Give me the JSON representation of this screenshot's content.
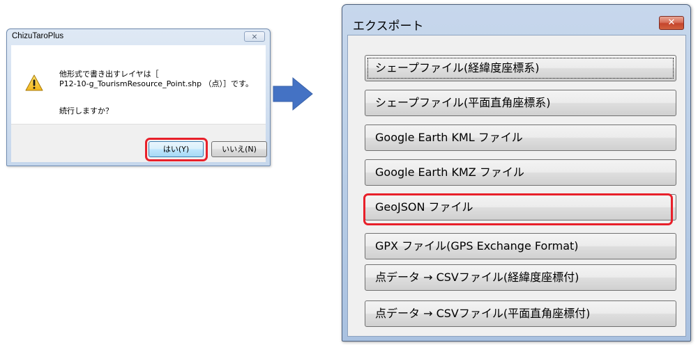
{
  "dialog": {
    "title": "ChizuTaroPlus",
    "close_glyph": "⨯",
    "icon": "warning-icon",
    "message_line1": "他形式で書き出すレイヤは［",
    "message_line2": "P12-10-g_TourismResource_Point.shp （点）］です。",
    "question": "続行しますか？",
    "yes_label": "はい(Y)",
    "no_label": "いいえ(N)"
  },
  "arrow": {
    "icon": "right-arrow-icon",
    "color": "#4472c4"
  },
  "highlight_color": "#e8202a",
  "export": {
    "title": "エクスポート",
    "close_glyph": "✕",
    "items": [
      {
        "label": "シェープファイル(経緯度座標系)"
      },
      {
        "label": "シェープファイル(平面直角座標系)"
      },
      {
        "label": "Google Earth KML ファイル"
      },
      {
        "label": "Google Earth KMZ ファイル"
      },
      {
        "label": "GeoJSON ファイル"
      },
      {
        "label": "GPX ファイル(GPS Exchange Format)"
      },
      {
        "label": "点データ → CSVファイル(経緯度座標付)"
      },
      {
        "label": "点データ → CSVファイル(平面直角座標付)"
      }
    ]
  }
}
